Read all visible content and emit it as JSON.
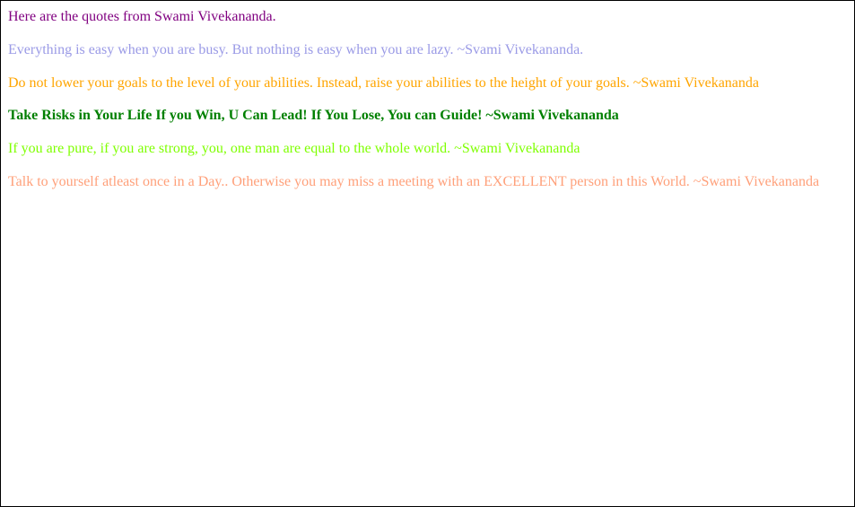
{
  "heading": "Here are the quotes from Swami Vivekananda.",
  "quotes": [
    "Everything is easy when you are busy. But nothing is easy when you are lazy. ~Svami Vivekananda.",
    "Do not lower your goals to the level of your abilities. Instead, raise your abilities to the height of your goals. ~Swami Vivekananda",
    "Take Risks in Your Life If you Win, U Can Lead! If You Lose, You can Guide! ~Swami Vivekananda",
    "If you are pure, if you are strong, you, one man are equal to the whole world. ~Swami Vivekananda",
    "Talk to yourself atleast once in a Day.. Otherwise you may miss a meeting with an EXCELLENT person in this World. ~Swami Vivekananda"
  ]
}
